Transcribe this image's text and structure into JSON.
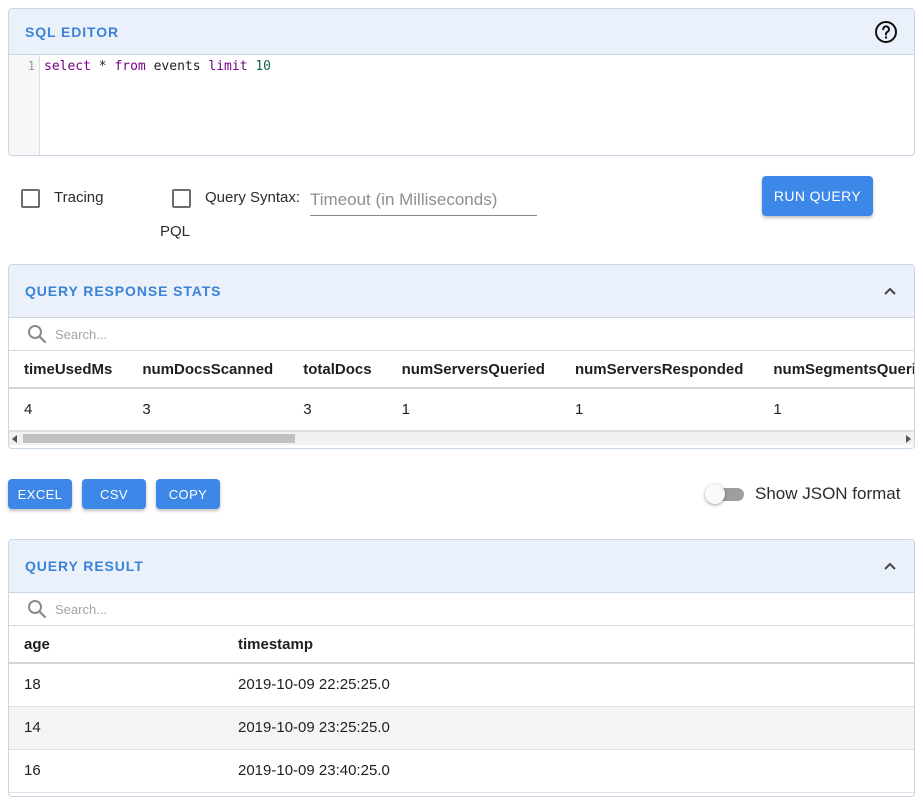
{
  "sql_editor": {
    "title": "SQL EDITOR",
    "line_number": "1",
    "query_tokens": {
      "select": "select",
      "star": " * ",
      "from": "from",
      "table": " events ",
      "limit": "limit",
      "space": " ",
      "number": "10"
    },
    "help_icon": "help-circle-icon"
  },
  "controls": {
    "tracing_label": "Tracing",
    "query_syntax_label": "Query Syntax:",
    "pql_label": "PQL",
    "timeout_placeholder": "Timeout (in Milliseconds)",
    "run_query_label": "RUN QUERY",
    "tracing_checked": false,
    "pql_checked": false
  },
  "stats": {
    "title": "QUERY RESPONSE STATS",
    "search_placeholder": "Search...",
    "columns": [
      "timeUsedMs",
      "numDocsScanned",
      "totalDocs",
      "numServersQueried",
      "numServersResponded",
      "numSegmentsQueried"
    ],
    "rows": [
      [
        "4",
        "3",
        "3",
        "1",
        "1",
        "1"
      ]
    ]
  },
  "export": {
    "excel_label": "EXCEL",
    "csv_label": "CSV",
    "copy_label": "COPY",
    "json_toggle_label": "Show JSON format",
    "json_toggle_on": false
  },
  "result": {
    "title": "QUERY RESULT",
    "search_placeholder": "Search...",
    "columns": [
      "age",
      "timestamp"
    ],
    "rows": [
      [
        "18",
        "2019-10-09 22:25:25.0"
      ],
      [
        "14",
        "2019-10-09 23:25:25.0"
      ],
      [
        "16",
        "2019-10-09 23:40:25.0"
      ]
    ]
  },
  "colors": {
    "accent": "#3c87e8",
    "header_bg": "#eaf1fb",
    "title_blue": "#3b83d6"
  }
}
